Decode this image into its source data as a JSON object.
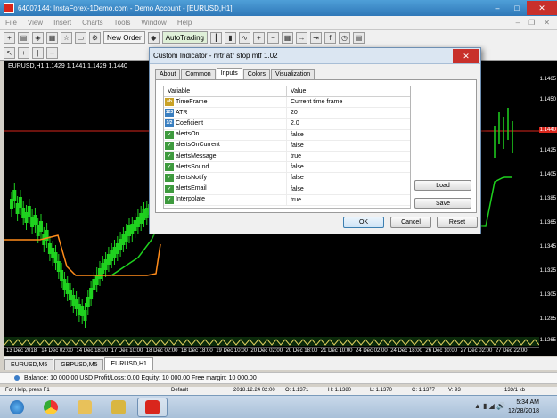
{
  "window": {
    "title": "64007144: InstaForex-1Demo.com - Demo Account - [EURUSD,H1]",
    "min": "–",
    "max": "□",
    "close": "✕"
  },
  "menu": {
    "items": [
      "File",
      "View",
      "Insert",
      "Charts",
      "Tools",
      "Window",
      "Help"
    ],
    "mdi_min": "–",
    "mdi_restore": "❐",
    "mdi_close": "✕"
  },
  "toolbar": {
    "new_order": "New Order",
    "autotrading": "AutoTrading"
  },
  "chart": {
    "symbol_info": "EURUSD,H1  1.1429 1.1441 1.1429 1.1440",
    "price_ticks": [
      "1.1465",
      "1.1450",
      "1.1440",
      "1.1425",
      "1.1405",
      "1.1385",
      "1.1365",
      "1.1345",
      "1.1325",
      "1.1305",
      "1.1285",
      "1.1265"
    ],
    "current_price": "1.1440",
    "time_ticks": [
      "13 Dec 2018",
      "14 Dec 02:00",
      "14 Dec 18:00",
      "17 Dec 10:00",
      "18 Dec 02:00",
      "18 Dec 18:00",
      "19 Dec 10:00",
      "20 Dec 02:00",
      "20 Dec 18:00",
      "21 Dec 10:00",
      "24 Dec 02:00",
      "24 Dec 18:00",
      "26 Dec 10:00",
      "27 Dec 02:00",
      "27 Dec 22:00"
    ],
    "colors": {
      "bull": "#1fd21f",
      "bear": "#1fd21f",
      "stop_down": "#ff8c1a",
      "stop_up": "#1fd21f",
      "level": "#d9261c"
    }
  },
  "chart_tabs": [
    "EURUSD,M5",
    "GBPUSD,M5",
    "EURUSD,H1"
  ],
  "balance_bar": {
    "text": "Balance: 10 000.00 USD  Profit/Loss: 0.00  Equity: 10 000.00  Free margin: 10 000.00"
  },
  "statusbar": {
    "help": "For Help, press F1",
    "profile": "Default",
    "datetime": "2018.12.24 02:00",
    "open": "O: 1.1371",
    "high": "H: 1.1380",
    "low": "L: 1.1370",
    "close": "C: 1.1377",
    "volume": "V: 93",
    "traffic": "133/1 kb"
  },
  "taskbar": {
    "time": "5:34 AM",
    "date": "12/28/2018"
  },
  "dialog": {
    "title": "Custom Indicator - nrtr atr stop mtf 1.02",
    "close": "✕",
    "tabs": [
      "About",
      "Common",
      "Inputs",
      "Colors",
      "Visualization"
    ],
    "col_variable": "Variable",
    "col_value": "Value",
    "rows": [
      {
        "icon": "ab",
        "glyph": "ab",
        "name": "TimeFrame",
        "value": "Current time frame"
      },
      {
        "icon": "num",
        "glyph": "123",
        "name": "ATR",
        "value": "20"
      },
      {
        "icon": "num",
        "glyph": "1/2",
        "name": "Coeficient",
        "value": "2.0"
      },
      {
        "icon": "bool",
        "glyph": "✓",
        "name": "alertsOn",
        "value": "false"
      },
      {
        "icon": "bool",
        "glyph": "✓",
        "name": "alertsOnCurrent",
        "value": "false"
      },
      {
        "icon": "bool",
        "glyph": "✓",
        "name": "alertsMessage",
        "value": "true"
      },
      {
        "icon": "bool",
        "glyph": "✓",
        "name": "alertsSound",
        "value": "false"
      },
      {
        "icon": "bool",
        "glyph": "✓",
        "name": "alertsNotify",
        "value": "false"
      },
      {
        "icon": "bool",
        "glyph": "✓",
        "name": "alertsEmail",
        "value": "false"
      },
      {
        "icon": "bool",
        "glyph": "✓",
        "name": "Interpolate",
        "value": "true"
      }
    ],
    "load": "Load",
    "save": "Save",
    "ok": "OK",
    "cancel": "Cancel",
    "reset": "Reset"
  }
}
